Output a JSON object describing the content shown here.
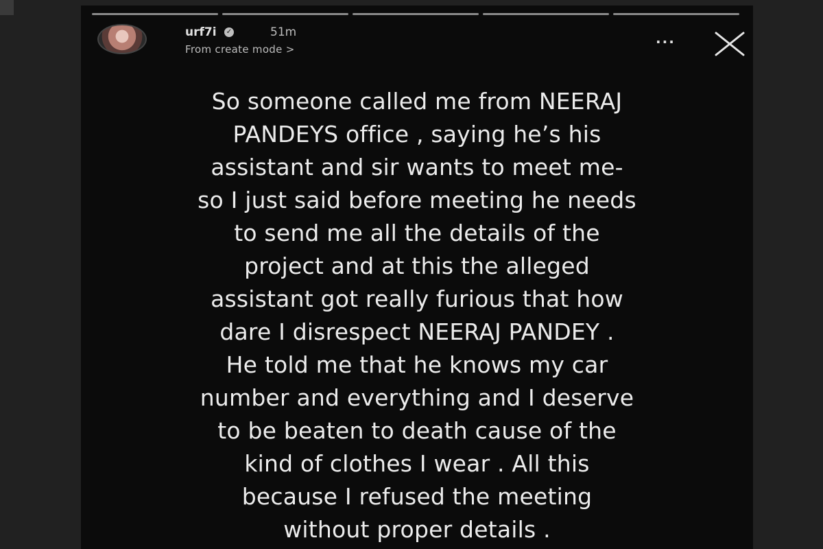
{
  "story": {
    "username": "urf7i",
    "time": "51m",
    "subtitle": "From create mode >",
    "more_label": "...",
    "segments": 5,
    "lines": [
      "So someone called me from NEERAJ",
      "PANDEYS office , saying he’s his",
      "assistant and sir wants to meet me-",
      "so I just said before meeting he needs",
      "to send me all the details of the",
      "project and at this the alleged",
      "assistant got really furious that how",
      "dare I disrespect NEERAJ PANDEY .",
      "He told me that he knows my car",
      "number and everything and I deserve",
      "to be beaten to death cause of the",
      "kind of clothes I wear . All this",
      "because I refused the meeting",
      "without proper details ."
    ]
  },
  "icons": {
    "avatar": "profile-avatar",
    "verified": "verified-badge-icon",
    "more": "more-options-icon",
    "close": "close-icon"
  },
  "colors": {
    "story_background": "#0b0b0b",
    "text": "#ececec",
    "progress": "#8a8a8a"
  }
}
